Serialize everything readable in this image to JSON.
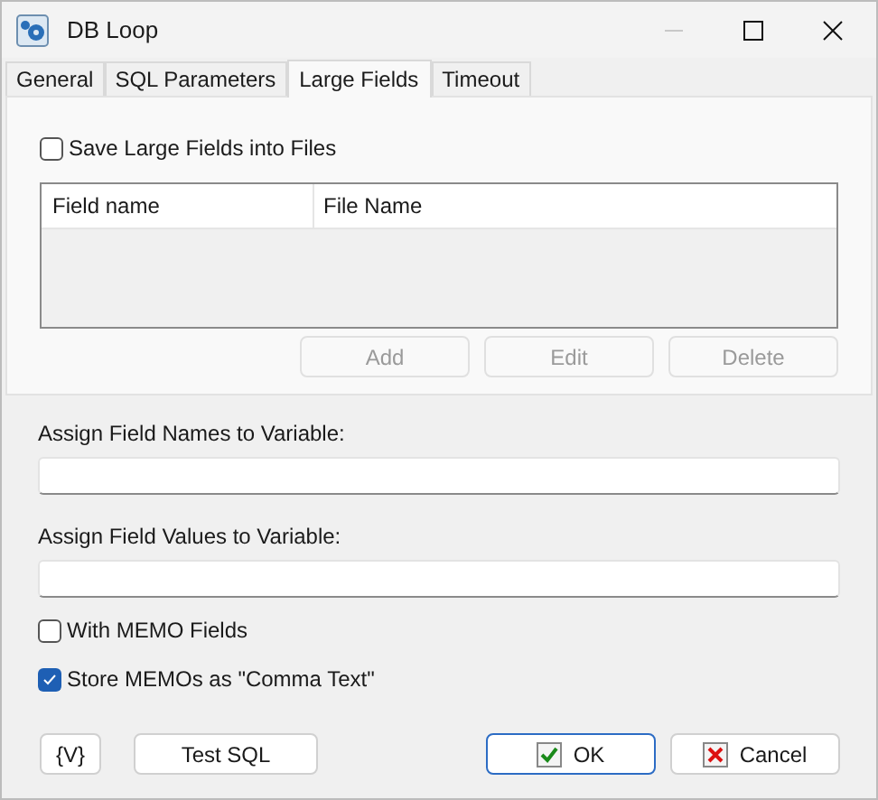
{
  "window": {
    "title": "DB Loop"
  },
  "tabs": [
    {
      "label": "General",
      "selected": false
    },
    {
      "label": "SQL Parameters",
      "selected": false
    },
    {
      "label": "Large Fields",
      "selected": true
    },
    {
      "label": "Timeout",
      "selected": false
    }
  ],
  "save_large_fields": {
    "label": "Save Large Fields into Files",
    "checked": false
  },
  "table": {
    "columns": [
      "Field name",
      "File Name"
    ]
  },
  "table_buttons": [
    {
      "label": "Add",
      "disabled": true
    },
    {
      "label": "Edit",
      "disabled": true
    },
    {
      "label": "Delete",
      "disabled": true
    }
  ],
  "fields": [
    {
      "label": "Assign Field Names to Variable:"
    },
    {
      "label": "Assign Field Values to Variable:"
    }
  ],
  "options": [
    {
      "label": "With MEMO Fields",
      "checked": false
    },
    {
      "label": "Store MEMOs as \"Comma Text\"",
      "checked": true
    }
  ],
  "buttons": [
    {
      "kind": "variable",
      "label": "{V}"
    },
    {
      "kind": "plain",
      "label": "Test SQL"
    },
    {
      "kind": "ok",
      "label": "OK"
    },
    {
      "kind": "cancel",
      "label": "Cancel"
    }
  ]
}
